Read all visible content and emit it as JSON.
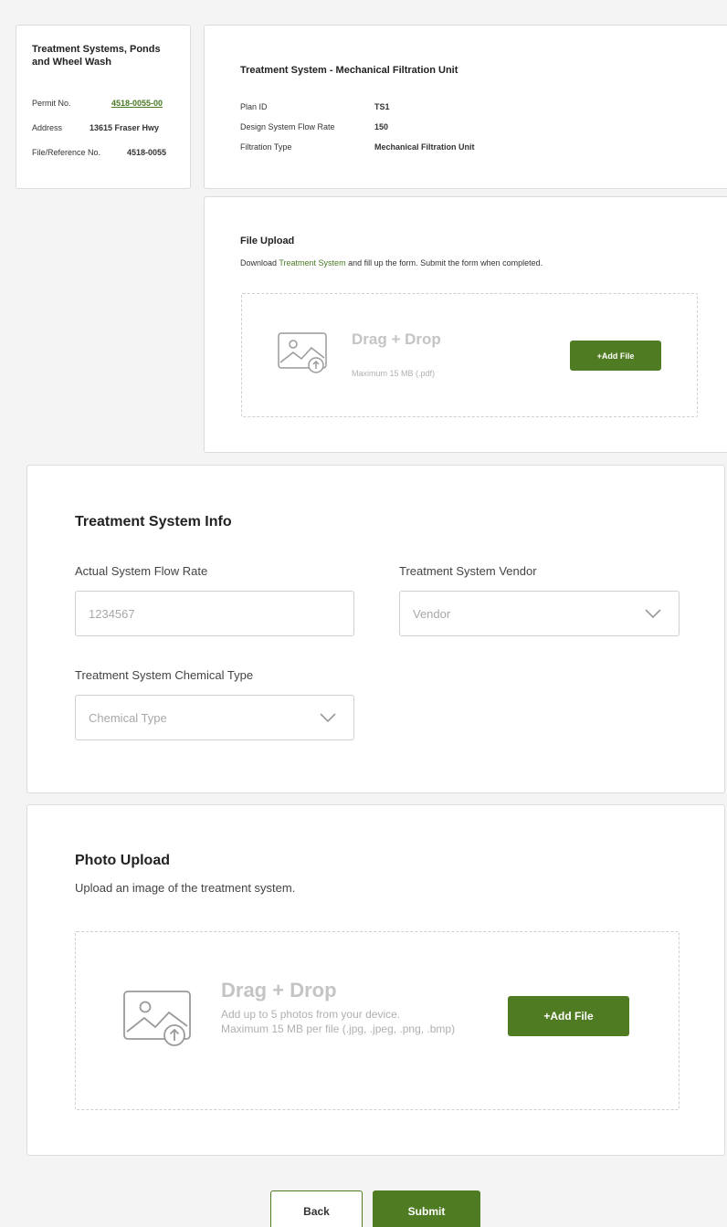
{
  "summary": {
    "title": "Treatment Systems, Ponds and Wheel Wash",
    "permit_label": "Permit No.",
    "permit_value": "4518-0055-00",
    "address_label": "Address",
    "address_value": "13615 Fraser Hwy",
    "file_label": "File/Reference No.",
    "file_value": "4518-0055"
  },
  "system": {
    "title": "Treatment System - Mechanical Filtration Unit",
    "rows": [
      {
        "label": "Plan ID",
        "value": "TS1"
      },
      {
        "label": "Design System Flow Rate",
        "value": "150"
      },
      {
        "label": "Filtration Type",
        "value": "Mechanical Filtration Unit"
      }
    ]
  },
  "file_upload": {
    "title": "File Upload",
    "desc_before": "Download ",
    "desc_link": "Treatment System",
    "desc_after": " and fill up the form. Submit the form when completed.",
    "drag_title": "Drag + Drop",
    "drag_sub": "Maximum 15 MB (.pdf)",
    "button": "+Add File",
    "icon": "image-upload-icon"
  },
  "ts_info": {
    "title": "Treatment System Info",
    "flow_label": "Actual System Flow Rate",
    "flow_value": "1234567",
    "vendor_label": "Treatment System Vendor",
    "vendor_value": "Vendor",
    "chem_label": "Treatment System Chemical Type",
    "chem_value": "Chemical Type"
  },
  "photo_upload": {
    "title": "Photo Upload",
    "desc": "Upload an image of the treatment system.",
    "drag_title": "Drag + Drop",
    "drag_sub_1": "Add up to 5 photos from your device.",
    "drag_sub_2": "Maximum 15 MB per file (.jpg, .jpeg, .png, .bmp)",
    "button": "+Add File",
    "icon": "image-upload-icon"
  },
  "actions": {
    "back": "Back",
    "submit": "Submit"
  },
  "colors": {
    "accent": "#4f7c22",
    "background": "#f4f4f4"
  }
}
